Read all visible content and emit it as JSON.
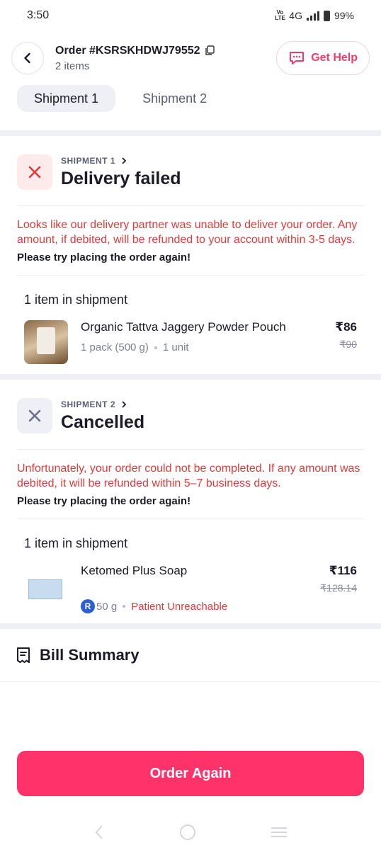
{
  "status_bar": {
    "time": "3:50",
    "network": "4G",
    "volte": "Vo LTE",
    "battery": "99%"
  },
  "header": {
    "order_id": "Order #KSRSKHDWJ79552",
    "item_count": "2 items",
    "help_label": "Get Help"
  },
  "tabs": [
    {
      "label": "Shipment 1",
      "active": true
    },
    {
      "label": "Shipment 2",
      "active": false
    }
  ],
  "shipments": [
    {
      "label": "SHIPMENT 1",
      "status": "Delivery failed",
      "message": "Looks like our delivery partner was unable to deliver your order. Any amount, if debited, will be refunded to your account within 3-5 days.",
      "retry": "Please try placing the order again!",
      "items_heading": "1 item in shipment",
      "item": {
        "name": "Organic Tattva Jaggery Powder Pouch",
        "pack": "1 pack (500 g)",
        "qty": "1 unit",
        "price": "₹86",
        "mrp": "₹90"
      }
    },
    {
      "label": "SHIPMENT 2",
      "status": "Cancelled",
      "message": "Unfortunately, your order could not be completed. If any amount was debited, it will be refunded within 5–7 business days.",
      "retry": "Please try placing the order again!",
      "items_heading": "1 item in shipment",
      "item": {
        "name": "Ketomed Plus Soap",
        "rx": "R",
        "pack": "50 g",
        "reason": "Patient Unreachable",
        "price": "₹116",
        "mrp": "₹128.14"
      }
    }
  ],
  "bill_summary": {
    "label": "Bill Summary"
  },
  "cta": {
    "label": "Order Again"
  },
  "icons": {
    "back": "chevron-left-icon",
    "copy": "copy-icon",
    "help": "chat-icon",
    "failed": "close-icon",
    "cancelled": "close-icon",
    "bill": "receipt-icon"
  },
  "colors": {
    "accent": "#ff3269",
    "error": "#e03b3b"
  }
}
